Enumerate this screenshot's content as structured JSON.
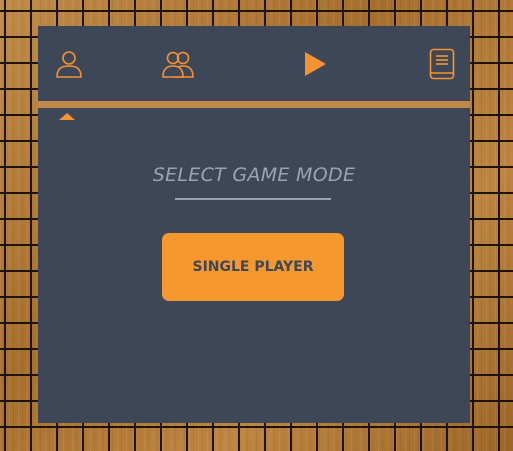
{
  "nav": {
    "items": [
      {
        "icon": "single-player-icon",
        "name": "tab-single-player"
      },
      {
        "icon": "multiplayer-icon",
        "name": "tab-multiplayer"
      },
      {
        "icon": "play-icon",
        "name": "tab-play"
      },
      {
        "icon": "book-icon",
        "name": "tab-rules"
      }
    ],
    "active_index": 0
  },
  "main": {
    "title": "SELECT GAME MODE",
    "mode_button_label": "SINGLE PLAYER"
  },
  "colors": {
    "accent": "#f7982f",
    "panel": "#3d4757",
    "muted_text": "#98a4b4",
    "wood": "#b07a3a"
  }
}
